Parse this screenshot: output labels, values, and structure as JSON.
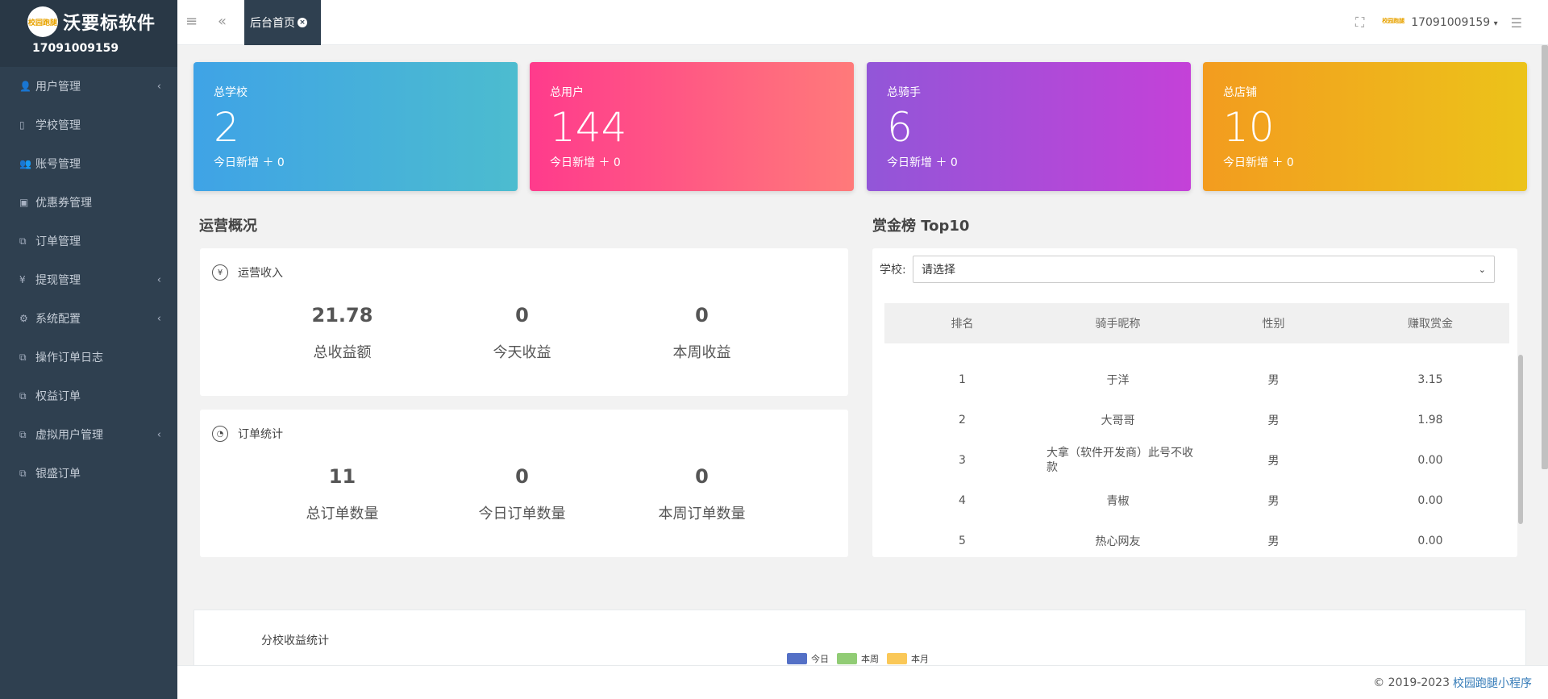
{
  "brand": {
    "logo_text": "校园跑腿",
    "name": "沃要标软件",
    "user": "17091009159"
  },
  "sidebar": {
    "items": [
      {
        "icon": "user-icon",
        "glyph": "👤",
        "label": "用户管理",
        "has_children": true
      },
      {
        "icon": "building-icon",
        "glyph": "▯",
        "label": "学校管理",
        "has_children": false
      },
      {
        "icon": "users-icon",
        "glyph": "👥",
        "label": "账号管理",
        "has_children": false
      },
      {
        "icon": "ticket-icon",
        "glyph": "▣",
        "label": "优惠券管理",
        "has_children": false
      },
      {
        "icon": "copy-icon",
        "glyph": "⧉",
        "label": "订单管理",
        "has_children": false
      },
      {
        "icon": "yen-icon",
        "glyph": "¥",
        "label": "提现管理",
        "has_children": true
      },
      {
        "icon": "gear-icon",
        "glyph": "⚙",
        "label": "系统配置",
        "has_children": true
      },
      {
        "icon": "copy-icon",
        "glyph": "⧉",
        "label": "操作订单日志",
        "has_children": false
      },
      {
        "icon": "copy-icon",
        "glyph": "⧉",
        "label": "权益订单",
        "has_children": false
      },
      {
        "icon": "copy-icon",
        "glyph": "⧉",
        "label": "虚拟用户管理",
        "has_children": true
      },
      {
        "icon": "copy-icon",
        "glyph": "⧉",
        "label": "银盛订单",
        "has_children": false
      }
    ]
  },
  "topbar": {
    "active_tab": "后台首页",
    "user": "17091009159",
    "avatar_text": "校园跑腿"
  },
  "cards": [
    {
      "title": "总学校",
      "value": "2",
      "note": "今日新增 ＋ 0"
    },
    {
      "title": "总用户",
      "value": "144",
      "note": "今日新增 ＋ 0"
    },
    {
      "title": "总骑手",
      "value": "6",
      "note": "今日新增 ＋ 0"
    },
    {
      "title": "总店铺",
      "value": "10",
      "note": "今日新增 ＋ 0"
    }
  ],
  "operations": {
    "title": "运营概况",
    "income": {
      "title": "运营收入",
      "stats": [
        {
          "value": "21.78",
          "label": "总收益额"
        },
        {
          "value": "0",
          "label": "今天收益"
        },
        {
          "value": "0",
          "label": "本周收益"
        }
      ]
    },
    "orders": {
      "title": "订单统计",
      "stats": [
        {
          "value": "11",
          "label": "总订单数量"
        },
        {
          "value": "0",
          "label": "今日订单数量"
        },
        {
          "value": "0",
          "label": "本周订单数量"
        }
      ]
    }
  },
  "ranking": {
    "title": "赏金榜 Top10",
    "school_label": "学校:",
    "school_placeholder": "请选择",
    "headers": [
      "排名",
      "骑手昵称",
      "性别",
      "赚取赏金"
    ],
    "rows": [
      [
        "1",
        "于洋",
        "男",
        "3.15"
      ],
      [
        "2",
        "大哥哥",
        "男",
        "1.98"
      ],
      [
        "3",
        "大拿（软件开发商）此号不收款",
        "男",
        "0.00"
      ],
      [
        "4",
        "青椒",
        "男",
        "0.00"
      ],
      [
        "5",
        "热心网友",
        "男",
        "0.00"
      ]
    ]
  },
  "chart": {
    "title": "分校收益统计",
    "legend": [
      {
        "name": "今日",
        "color": "#5470c6"
      },
      {
        "name": "本周",
        "color": "#91cc75"
      },
      {
        "name": "本月",
        "color": "#fac858"
      }
    ]
  },
  "footer": {
    "copyright": "© 2019-2023",
    "link": "校园跑腿小程序"
  }
}
